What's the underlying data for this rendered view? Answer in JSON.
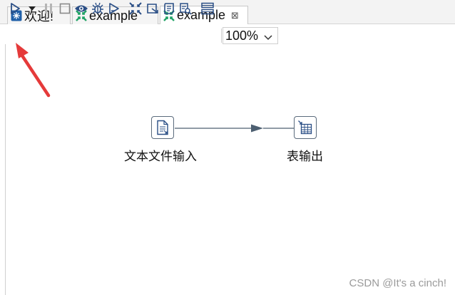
{
  "tabs": [
    {
      "label": "欢迎!",
      "icon": "spoon-welcome-icon"
    },
    {
      "label": "example",
      "icon": "transformation-icon"
    },
    {
      "label": "example",
      "icon": "transformation-icon",
      "active": true,
      "close_symbol": "⊠"
    }
  ],
  "toolbar": {
    "buttons": [
      "run-icon",
      "run-options-dropdown-icon",
      "pause-icon",
      "stop-icon",
      "preview-icon",
      "debug-icon",
      "replay-icon",
      "verify-icon",
      "impact-icon",
      "sql-icon",
      "explore-db-icon",
      "show-results-icon"
    ],
    "zoom": "100%"
  },
  "steps": [
    {
      "label": "文本文件输入",
      "icon": "text-file-input-icon"
    },
    {
      "label": "表输出",
      "icon": "table-output-icon"
    }
  ],
  "hop": {
    "from": "文本文件输入",
    "to": "表输出"
  },
  "annotation": {
    "arrow_color": "#e53a3a",
    "points_to": "run-icon"
  },
  "watermark": "CSDN @It's a cinch!",
  "colors": {
    "accent_green": "#21a366",
    "tab_blue": "#1f5fa8",
    "hop": "#4d5f71"
  }
}
